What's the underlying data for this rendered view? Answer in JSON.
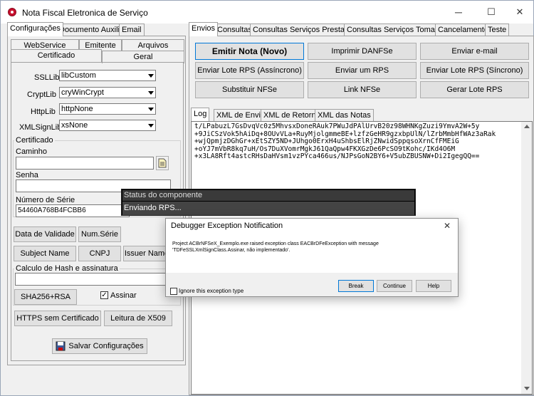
{
  "window": {
    "title": "Nota Fiscal Eletronica de Serviço",
    "minimize": "─",
    "maximize": "☐",
    "close": "✕"
  },
  "left_tabs": [
    "Configurações",
    "Documento Auxiliar",
    "Email"
  ],
  "left_subtabs_row1": [
    "WebService",
    "Emitente",
    "Arquivos"
  ],
  "left_subtabs_row2": [
    "Certificado",
    "Geral"
  ],
  "cert": {
    "ssllib_label": "SSLLib",
    "ssllib_value": "libCustom",
    "cryptlib_label": "CryptLib",
    "cryptlib_value": "cryWinCrypt",
    "httplib_label": "HttpLib",
    "httplib_value": "httpNone",
    "xmlsignlib_label": "XMLSignLib",
    "xmlsignlib_value": "xsNone",
    "group_title": "Certificado",
    "caminho_label": "Caminho",
    "caminho_value": "",
    "senha_label": "Senha",
    "senha_value": "",
    "numserie_label": "Número de Série",
    "numserie_value": "54460A768B4FCBB6",
    "btn_data_validade": "Data de Validade",
    "btn_num_serie": "Num.Série",
    "btn_subject_name": "Subject Name",
    "btn_cnpj": "CNPJ",
    "btn_issuer_name": "Issuer Name",
    "hash_group_title": "Calculo de Hash e assinatura",
    "hash_value": "",
    "btn_sha256": "SHA256+RSA",
    "assinar_label": "Assinar",
    "assinar_check": "✓",
    "btn_https": "HTTPS sem Certificado",
    "btn_x509": "Leitura de X509",
    "btn_salvar": "Salvar Configurações"
  },
  "right_tabs": [
    "Envios",
    "Consultas",
    "Consultas Serviços Prestados",
    "Consultas Serviços Tomados",
    "Cancelamento",
    "Teste"
  ],
  "actions": {
    "emitir": "Emitir Nota (Novo)",
    "imprimir": "Imprimir DANFSe",
    "enviar_email": "Enviar e-mail",
    "lote_assinc": "Enviar Lote RPS (Assíncrono)",
    "enviar_um": "Enviar um RPS",
    "lote_sinc": "Enviar Lote RPS (Síncrono)",
    "substituir": "Substituir NFSe",
    "link": "Link NFSe",
    "gerar_lote": "Gerar Lote RPS"
  },
  "log_tabs": [
    "Log",
    "XML de Envio",
    "XML de Retorno",
    "XML das Notas"
  ],
  "log_lines": [
    "t/LPabuzL7GsDvqVc0z5MhvsxDoneRAuk7PWuJdPAlUrvB20z98WHNKgZuzi9YmvA2W+5y",
    "+9JiCSzVok5hAiDq+8OUvVLa+RuyMjolgmmeBE+lzfzGeHR9gzxbpUlN/lZrbMmbHfWAz3aRak",
    "+wjQpmjzDGhGr+xEtSZY5ND+JUhgo0ErxH4uShbsElRjZNwidSppqsoXrnCfFMEiG",
    "+oYJ7mVbR8kq7uH/Os7DuXVomrMgkJ61QaQpw4FKXGzDe6PcSO9tKohc/IKd4O6M",
    "+x3LA8Rft4astcRHsDaHVsm1vzPYca466us/NJPsGoN2BY6+V5ubZBUSNW+Di2IgegQQ=="
  ],
  "status_window": {
    "title": "Status do componente",
    "message": "Enviando RPS..."
  },
  "dialog": {
    "title": "Debugger Exception Notification",
    "close": "✕",
    "message_line1": "Project ACBrNFSeX_Exemplo.exe raised exception class EACBrDFeException with message",
    "message_line2": "'TDFeSSLXmlSignClass.Assinar, não implementado'.",
    "ignore_label": "Ignore this exception type",
    "btn_break": "Break",
    "btn_continue": "Continue",
    "btn_help": "Help"
  }
}
